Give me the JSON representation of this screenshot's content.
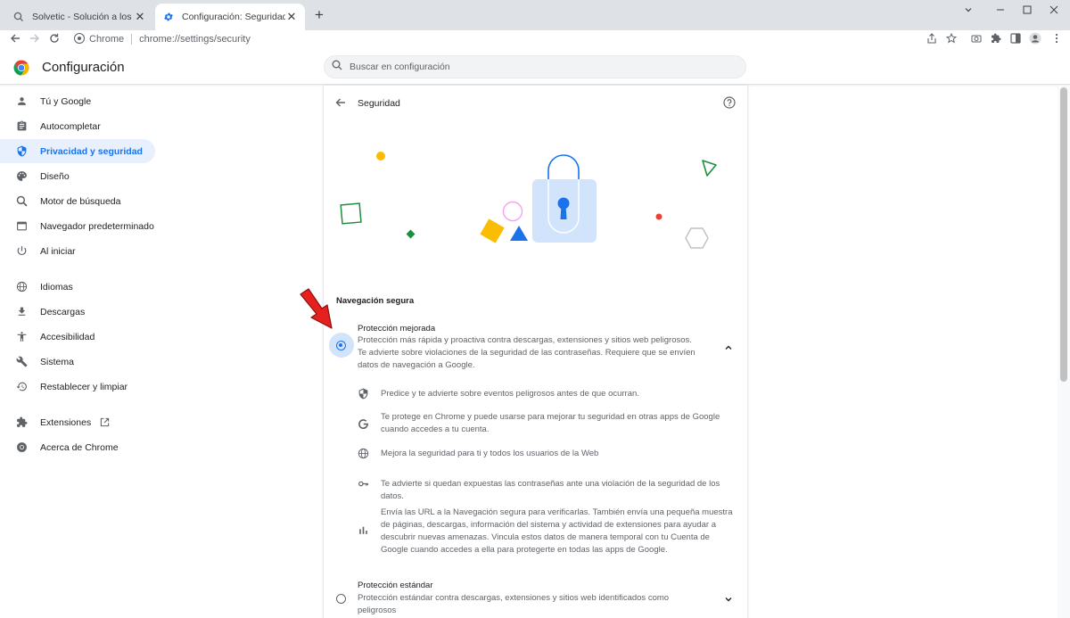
{
  "browser": {
    "tabs": [
      {
        "title": "Solvetic - Solución a los problemas",
        "active": false
      },
      {
        "title": "Configuración: Seguridad",
        "active": true
      }
    ],
    "omnibox": {
      "site_label": "Chrome",
      "url": "chrome://settings/security"
    }
  },
  "header": {
    "title": "Configuración",
    "search_placeholder": "Buscar en configuración"
  },
  "sidebar": {
    "items": [
      {
        "label": "Tú y Google",
        "icon": "person-icon"
      },
      {
        "label": "Autocompletar",
        "icon": "clipboard-icon"
      },
      {
        "label": "Privacidad y seguridad",
        "icon": "shield-icon",
        "active": true
      },
      {
        "label": "Diseño",
        "icon": "palette-icon"
      },
      {
        "label": "Motor de búsqueda",
        "icon": "search-icon"
      },
      {
        "label": "Navegador predeterminado",
        "icon": "browser-icon"
      },
      {
        "label": "Al iniciar",
        "icon": "power-icon"
      },
      {
        "label": "Idiomas",
        "icon": "globe-icon"
      },
      {
        "label": "Descargas",
        "icon": "download-icon"
      },
      {
        "label": "Accesibilidad",
        "icon": "accessibility-icon"
      },
      {
        "label": "Sistema",
        "icon": "wrench-icon"
      },
      {
        "label": "Restablecer y limpiar",
        "icon": "restore-icon"
      },
      {
        "label": "Extensiones",
        "icon": "puzzle-icon"
      },
      {
        "label": "Acerca de Chrome",
        "icon": "chrome-icon"
      }
    ]
  },
  "content": {
    "title": "Seguridad",
    "section_title": "Navegación segura",
    "enhanced": {
      "title": "Protección mejorada",
      "description": "Protección más rápida y proactiva contra descargas, extensiones y sitios web peligrosos. Te advierte sobre violaciones de la seguridad de las contraseñas. Requiere que se envíen datos de navegación a Google.",
      "selected": true
    },
    "features": [
      {
        "icon": "shield-icon",
        "text": "Predice y te advierte sobre eventos peligrosos antes de que ocurran."
      },
      {
        "icon": "google-g-icon",
        "text": "Te protege en Chrome y puede usarse para mejorar tu seguridad en otras apps de Google cuando accedes a tu cuenta."
      },
      {
        "icon": "globe-icon",
        "text": "Mejora la seguridad para ti y todos los usuarios de la Web"
      },
      {
        "icon": "key-icon",
        "text": "Te advierte si quedan expuestas las contraseñas ante una violación de la seguridad de los datos."
      },
      {
        "icon": "bar-chart-icon",
        "text": "Envía las URL a la Navegación segura para verificarlas. También envía una pequeña muestra de páginas, descargas, información del sistema y actividad de extensiones para ayudar a descubrir nuevas amenazas. Vincula estos datos de manera temporal con tu Cuenta de Google cuando accedes a ella para protegerte en todas las apps de Google."
      }
    ],
    "standard": {
      "title": "Protección estándar",
      "description": "Protección estándar contra descargas, extensiones y sitios web identificados como peligrosos",
      "selected": false
    }
  },
  "colors": {
    "accent": "#1a73e8",
    "active_bg": "#e8f0fe",
    "arrow": "#e5211f"
  }
}
